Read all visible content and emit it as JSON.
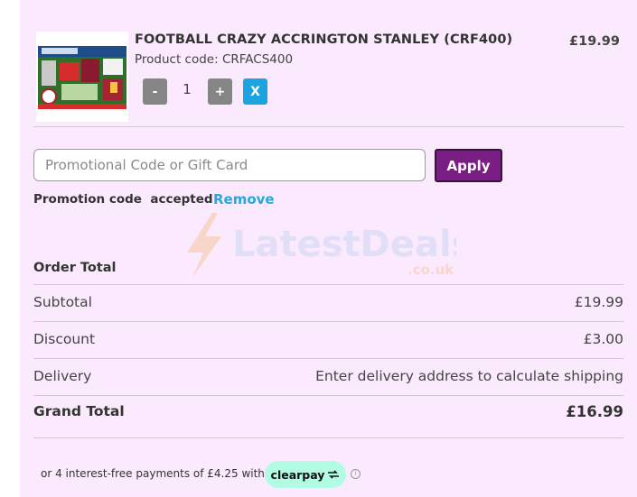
{
  "product": {
    "title": "FOOTBALL CRAZY ACCRINGTON STANLEY (CRF400)",
    "code": "Product code: CRFACS400",
    "price": "£19.99",
    "quantity": "1",
    "minus_label": "-",
    "plus_label": "+",
    "remove_label": "X",
    "image_icon": "product-thumbnail"
  },
  "promo": {
    "placeholder": "Promotional Code or Gift Card",
    "value": "",
    "apply_label": "Apply",
    "accepted_text": "Promotion code  accepted",
    "remove_label": "Remove"
  },
  "watermark": {
    "main": "LatestDeals",
    "sub": ".co.uk"
  },
  "order_total": {
    "title": "Order Total",
    "rows": [
      {
        "label": "Subtotal",
        "value": "£19.99"
      },
      {
        "label": "Discount",
        "value": "£3.00"
      },
      {
        "label": "Delivery",
        "value": "Enter delivery address to calculate shipping"
      }
    ],
    "grand_total_label": "Grand Total",
    "grand_total_value": "£16.99"
  },
  "payment": {
    "installments_text": "or 4 interest-free payments of £4.25 with",
    "provider": "clearpay",
    "info_icon": "i"
  },
  "colors": {
    "panel_bg": "#fbe9fd",
    "apply_bg": "#7b1e83",
    "remove_bg": "#1ca3e0",
    "link": "#2aa7dc",
    "clearpay_bg": "#b2fce4"
  }
}
